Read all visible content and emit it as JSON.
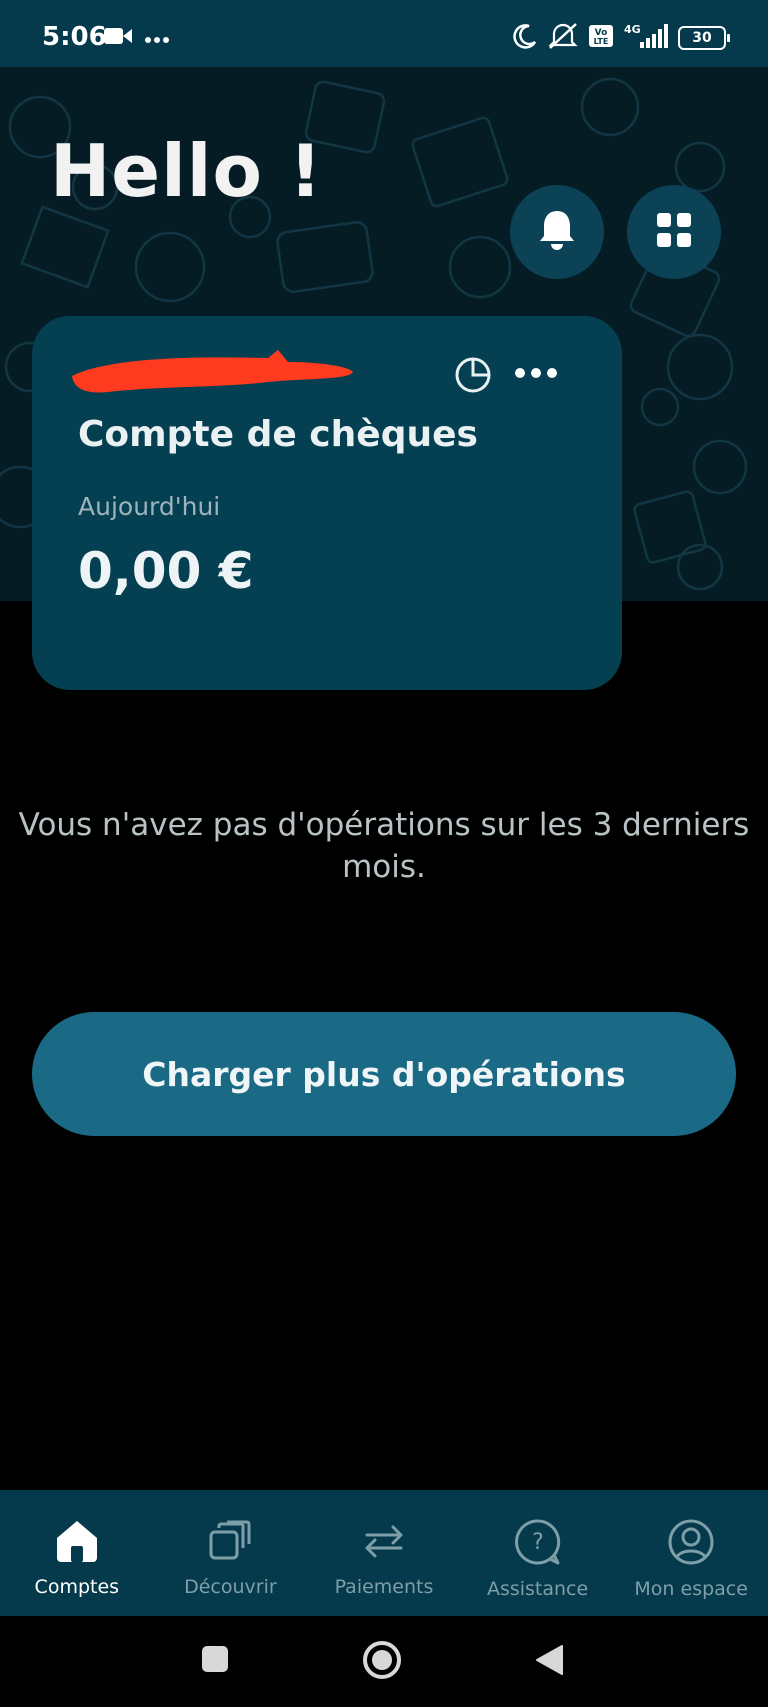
{
  "status_bar": {
    "time": "5:06",
    "network": "4G",
    "volte": "Vo LTE",
    "battery": "30"
  },
  "header": {
    "greeting": "Hello !"
  },
  "account": {
    "name": "Compte de chèques",
    "date_label": "Aujourd'hui",
    "balance": "0,00 €"
  },
  "operations": {
    "empty_message": "Vous n'avez pas d'opérations sur les 3 derniers mois.",
    "load_more_label": "Charger plus d'opérations"
  },
  "bottom_nav": {
    "items": [
      {
        "label": "Comptes",
        "icon": "home-icon",
        "active": true
      },
      {
        "label": "Découvrir",
        "icon": "stacked-cards-icon",
        "active": false
      },
      {
        "label": "Paiements",
        "icon": "transfer-arrows-icon",
        "active": false
      },
      {
        "label": "Assistance",
        "icon": "help-bubble-icon",
        "active": false
      },
      {
        "label": "Mon espace",
        "icon": "profile-icon",
        "active": false
      }
    ]
  },
  "colors": {
    "primary_dark": "#053a4c",
    "card": "#053f52",
    "button": "#1a6a86",
    "redaction": "#ff3b1f"
  }
}
